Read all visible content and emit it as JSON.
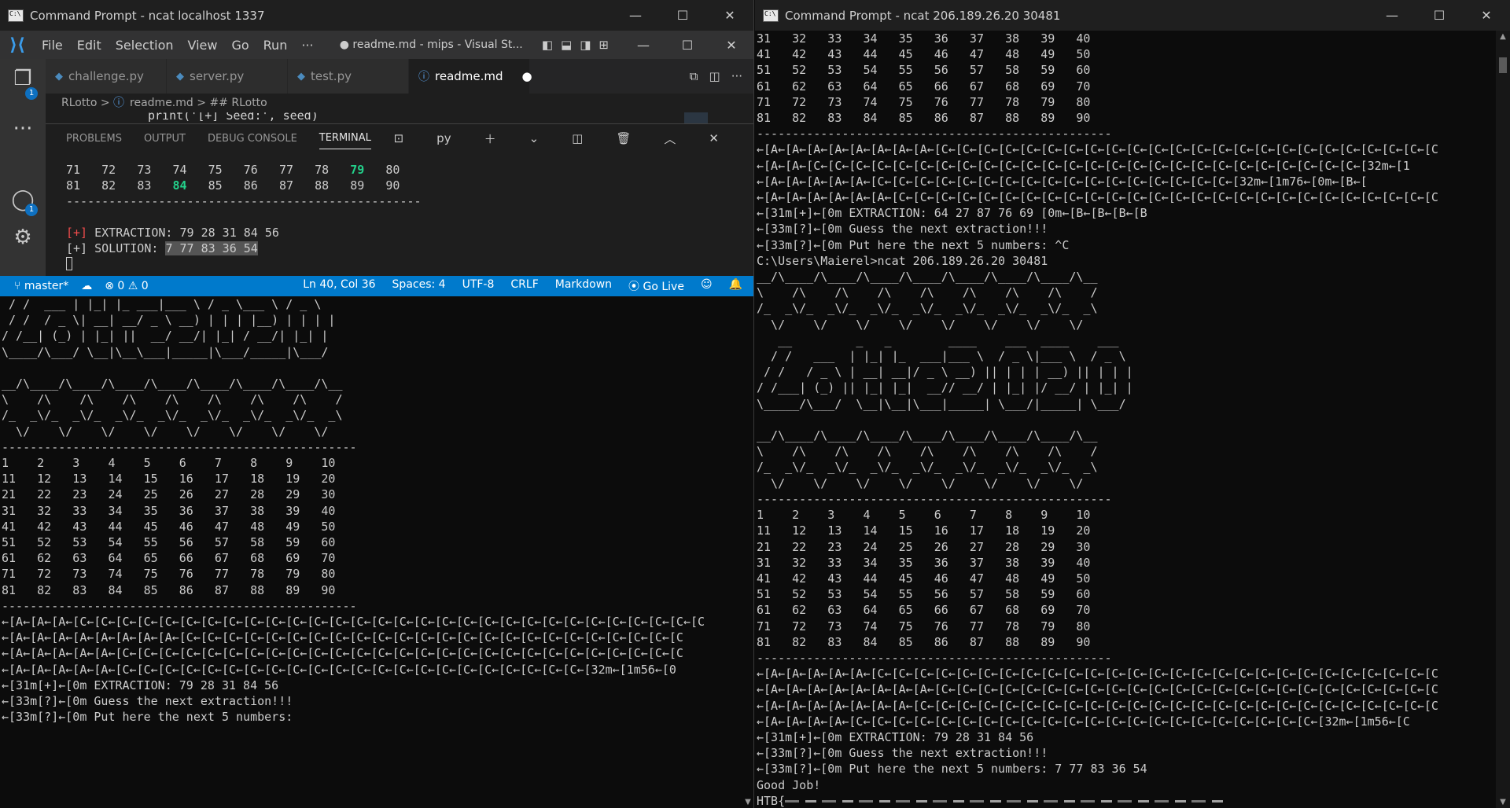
{
  "left_window": {
    "title": "Command Prompt - ncat  localhost 1337",
    "controls": {
      "minimize": "—",
      "maximize": "☐",
      "close": "✕"
    }
  },
  "right_window": {
    "title": "Command Prompt - ncat  206.189.26.20 30481",
    "controls": {
      "minimize": "—",
      "maximize": "☐",
      "close": "✕"
    }
  },
  "vscode": {
    "menu": [
      "File",
      "Edit",
      "Selection",
      "View",
      "Go",
      "Run",
      "···"
    ],
    "title": "● readme.md - mips - Visual St...",
    "tabs": [
      {
        "label": "challenge.py"
      },
      {
        "label": "server.py"
      },
      {
        "label": "test.py"
      },
      {
        "label": "readme.md",
        "dirty": "●"
      }
    ],
    "breadcrumb": [
      "RLotto",
      ">",
      "readme.md",
      ">",
      "## RLotto"
    ],
    "code_fragment": "print('[+] Seed:', seed)",
    "activity_badges": [
      "1",
      "1"
    ],
    "panel_tabs": [
      "PROBLEMS",
      "OUTPUT",
      "DEBUG CONSOLE",
      "TERMINAL"
    ],
    "panel_shell": "py",
    "terminal": {
      "row7": [
        "71",
        "72",
        "73",
        "74",
        "75",
        "76",
        "77",
        "78",
        "79",
        "80"
      ],
      "row8": [
        "81",
        "82",
        "83",
        "84",
        "85",
        "86",
        "87",
        "88",
        "89",
        "90"
      ],
      "separator": "--------------------------------------------------",
      "extraction_tag": "[+]",
      "extraction": "EXTRACTION: 79 28 31 84 56",
      "solution_prefix": "[+] SOLUTION: ",
      "solution_value": "7 77 83 36 54"
    },
    "status": {
      "branch": "master*",
      "problems": "⊗ 0 ⚠ 0",
      "position": "Ln 40, Col 36",
      "spaces": "Spaces: 4",
      "encoding": "UTF-8",
      "eol": "CRLF",
      "language": "Markdown",
      "golive": "Go Live"
    }
  },
  "left_terminal": " / /  ___ | |_| |_ ___|___ \\ / _ \\___ \\ / _ \\\n / /  / _ \\| __| __/ _ \\ __) | | | |__) | | | |\n/ /__| (_) | |_| ||  __/ __/| |_| / __/| |_| |\n\\____/\\___/ \\__|\\__\\___|_____|\\___/_____|\\___/\n\n__/\\____/\\____/\\____/\\____/\\____/\\____/\\____/\\__\n\\    /\\    /\\    /\\    /\\    /\\    /\\    /\\    /\n/_  _\\/_  _\\/_  _\\/_  _\\/_  _\\/_  _\\/_  _\\/_  _\\\n  \\/    \\/    \\/    \\/    \\/    \\/    \\/    \\/\n--------------------------------------------------\n1    2    3    4    5    6    7    8    9    10\n11   12   13   14   15   16   17   18   19   20\n21   22   23   24   25   26   27   28   29   30\n31   32   33   34   35   36   37   38   39   40\n41   42   43   44   45   46   47   48   49   50\n51   52   53   54   55   56   57   58   59   60\n61   62   63   64   65   66   67   68   69   70\n71   72   73   74   75   76   77   78   79   80\n81   82   83   84   85   86   87   88   89   90\n--------------------------------------------------\n←[A←[A←[A←[C←[C←[C←[C←[C←[C←[C←[C←[C←[C←[C←[C←[C←[C←[C←[C←[C←[C←[C←[C←[C←[C←[C←[C←[C←[C←[C←[C←[C←[C\n←[A←[A←[A←[A←[A←[A←[A←[A←[C←[C←[C←[C←[C←[C←[C←[C←[C←[C←[C←[C←[C←[C←[C←[C←[C←[C←[C←[C←[C←[C←[C←[C\n←[A←[A←[A←[A←[A←[C←[C←[C←[C←[C←[C←[C←[C←[C←[C←[C←[C←[C←[C←[C←[C←[C←[C←[C←[C←[C←[C←[C←[C←[C←[C←[C\n←[A←[A←[A←[A←[A←[C←[C←[C←[C←[C←[C←[C←[C←[C←[C←[C←[C←[C←[C←[C←[C←[C←[C←[C←[C←[C←[C←[32m←[1m56←[0\n←[31m[+]←[0m EXTRACTION: 79 28 31 84 56\n←[33m[?]←[0m Guess the next extraction!!!\n←[33m[?]←[0m Put here the next 5 numbers:",
  "right_terminal": "31   32   33   34   35   36   37   38   39   40\n41   42   43   44   45   46   47   48   49   50\n51   52   53   54   55   56   57   58   59   60\n61   62   63   64   65   66   67   68   69   70\n71   72   73   74   75   76   77   78   79   80\n81   82   83   84   85   86   87   88   89   90\n--------------------------------------------------\n←[A←[A←[A←[A←[A←[A←[A←[A←[C←[C←[C←[C←[C←[C←[C←[C←[C←[C←[C←[C←[C←[C←[C←[C←[C←[C←[C←[C←[C←[C←[C←[C\n←[A←[A←[C←[C←[C←[C←[C←[C←[C←[C←[C←[C←[C←[C←[C←[C←[C←[C←[C←[C←[C←[C←[C←[C←[C←[C←[C←[C←[32m←[1\n←[A←[A←[A←[A←[A←[C←[C←[C←[C←[C←[C←[C←[C←[C←[C←[C←[C←[C←[C←[C←[C←[C←[32m←[1m76←[0m←[B←[\n←[A←[A←[A←[A←[A←[A←[C←[C←[C←[C←[C←[C←[C←[C←[C←[C←[C←[C←[C←[C←[C←[C←[C←[C←[C←[C←[C←[C←[C←[C←[C←[C\n←[31m[+]←[0m EXTRACTION: 64 27 87 76 69 [0m←[B←[B←[B←[B\n←[33m[?]←[0m Guess the next extraction!!!\n←[33m[?]←[0m Put here the next 5 numbers: ^C\nC:\\Users\\Maierel>ncat 206.189.26.20 30481\n__/\\____/\\____/\\____/\\____/\\____/\\____/\\____/\\__\n\\    /\\    /\\    /\\    /\\    /\\    /\\    /\\    /\n/_  _\\/_  _\\/_  _\\/_  _\\/_  _\\/_  _\\/_  _\\/_  _\\\n  \\/    \\/    \\/    \\/    \\/    \\/    \\/    \\/\n   __         _   _        ____    ___  ____    ___\n  / /   ___  | |_| |_  ___|___ \\  / _ \\|___ \\  / _ \\\n / /   / _ \\ | __| __|/ _ \\ __) || | | | __) || | | |\n/ /___| (_) || |_| |_|  __// __/ | |_| |/ __/ | |_| |\n\\_____/\\___/  \\__|\\__|\\___|_____| \\___/|_____| \\___/\n\n__/\\____/\\____/\\____/\\____/\\____/\\____/\\____/\\__\n\\    /\\    /\\    /\\    /\\    /\\    /\\    /\\    /\n/_  _\\/_  _\\/_  _\\/_  _\\/_  _\\/_  _\\/_  _\\/_  _\\\n  \\/    \\/    \\/    \\/    \\/    \\/    \\/    \\/\n--------------------------------------------------\n1    2    3    4    5    6    7    8    9    10\n11   12   13   14   15   16   17   18   19   20\n21   22   23   24   25   26   27   28   29   30\n31   32   33   34   35   36   37   38   39   40\n41   42   43   44   45   46   47   48   49   50\n51   52   53   54   55   56   57   58   59   60\n61   62   63   64   65   66   67   68   69   70\n71   72   73   74   75   76   77   78   79   80\n81   82   83   84   85   86   87   88   89   90\n--------------------------------------------------\n←[A←[A←[A←[A←[A←[C←[C←[C←[C←[C←[C←[C←[C←[C←[C←[C←[C←[C←[C←[C←[C←[C←[C←[C←[C←[C←[C←[C←[C←[C←[C←[C\n←[A←[A←[A←[A←[A←[A←[A←[A←[C←[C←[C←[C←[C←[C←[C←[C←[C←[C←[C←[C←[C←[C←[C←[C←[C←[C←[C←[C←[C←[C←[C←[C\n←[A←[A←[A←[A←[A←[A←[A←[C←[C←[C←[C←[C←[C←[C←[C←[C←[C←[C←[C←[C←[C←[C←[C←[C←[C←[C←[C←[C←[C←[C←[C←[C\n←[A←[A←[A←[A←[C←[C←[C←[C←[C←[C←[C←[C←[C←[C←[C←[C←[C←[C←[C←[C←[C←[C←[C←[C←[C←[C←[32m←[1m56←[C\n←[31m[+]←[0m EXTRACTION: 79 28 31 84 56\n←[33m[?]←[0m Guess the next extraction!!!\n←[33m[?]←[0m Put here the next 5 numbers: 7 77 83 36 54\nGood Job!",
  "right_flag_prefix": "HTB{"
}
